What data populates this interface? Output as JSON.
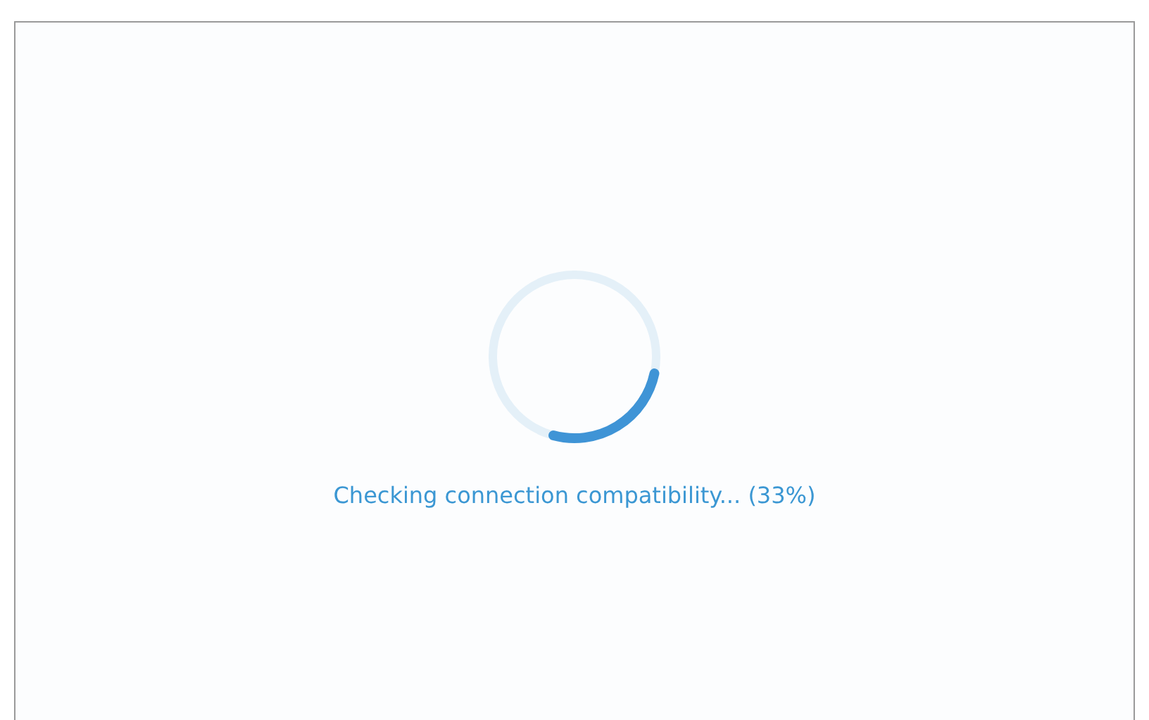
{
  "status": {
    "message": "Checking connection compatibility... (33%)"
  }
}
